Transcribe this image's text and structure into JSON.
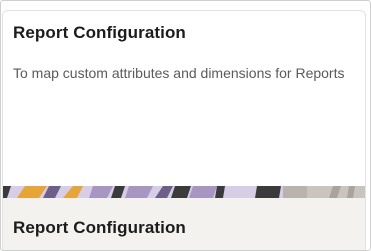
{
  "card": {
    "title": "Report Configuration",
    "description": "To map custom attributes and dimensions for Reports"
  },
  "footer": {
    "title": "Report Configuration"
  },
  "banner": {
    "icon": "decorative-pattern-banner",
    "colors": [
      "#e7a537",
      "#a896c2",
      "#6d5f8a",
      "#d6cde6",
      "#3b3b3b",
      "#b8b3ad"
    ]
  }
}
